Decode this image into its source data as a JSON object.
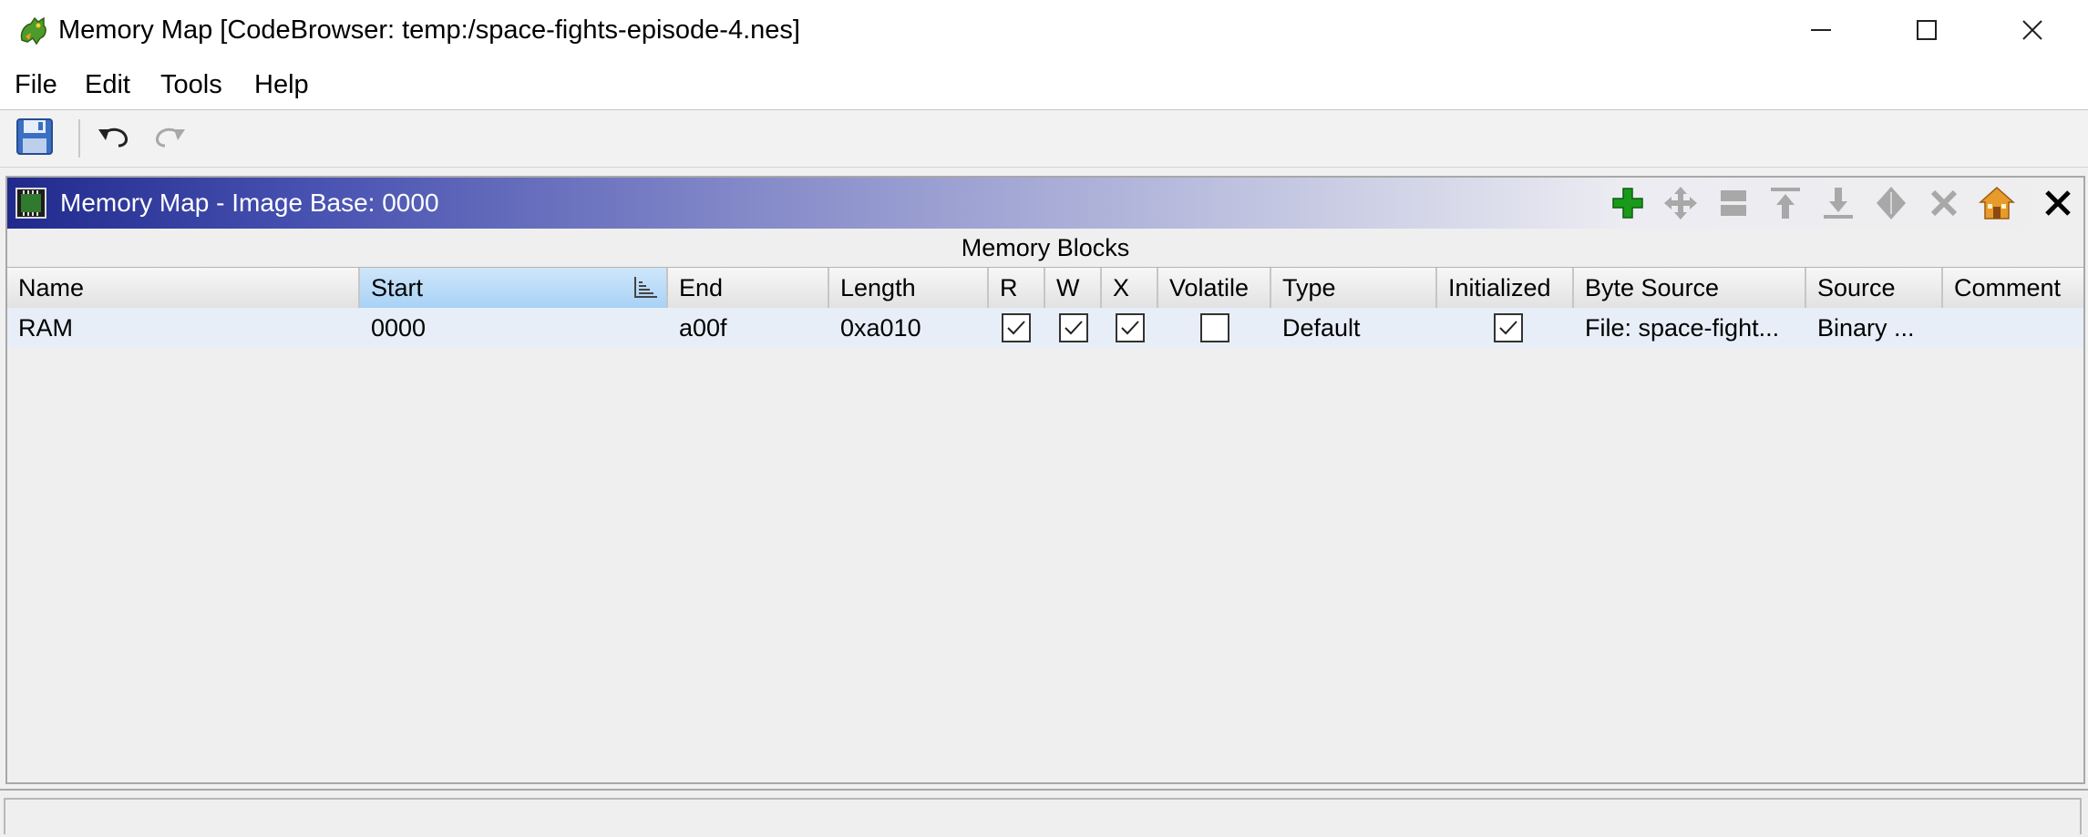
{
  "window": {
    "title": "Memory Map [CodeBrowser: temp:/space-fights-episode-4.nes]",
    "icon": "ghidra-dragon-icon",
    "controls": [
      "minimize-icon",
      "maximize-icon",
      "close-icon"
    ]
  },
  "menu": {
    "items": [
      "File",
      "Edit",
      "Tools",
      "Help"
    ]
  },
  "toolbar": {
    "buttons": [
      "save-icon",
      "undo-icon",
      "redo-icon"
    ]
  },
  "panel": {
    "title": "Memory Map - Image Base: 0000",
    "icon": "memory-chip-icon",
    "actions": [
      "add-block-icon",
      "move-block-icon",
      "split-block-icon",
      "expand-up-icon",
      "expand-down-icon",
      "merge-blocks-icon",
      "delete-block-icon",
      "set-image-base-icon",
      "close-panel-icon"
    ]
  },
  "table": {
    "title": "Memory Blocks",
    "sorted_column": "Start",
    "columns": [
      "Name",
      "Start",
      "End",
      "Length",
      "R",
      "W",
      "X",
      "Volatile",
      "Type",
      "Initialized",
      "Byte Source",
      "Source",
      "Comment"
    ],
    "rows": [
      {
        "name": "RAM",
        "start": "0000",
        "end": "a00f",
        "length": "0xa010",
        "r": true,
        "w": true,
        "x": true,
        "volatile": false,
        "type": "Default",
        "initialized": true,
        "byte_source": "File: space-fight...",
        "source": "Binary ...",
        "comment": ""
      }
    ]
  },
  "colors": {
    "header_gradient_start": "#1f2a8c",
    "selected_header": "#a8d2f5",
    "row_highlight": "#e8eef8",
    "add_green": "#1a9a1a"
  }
}
